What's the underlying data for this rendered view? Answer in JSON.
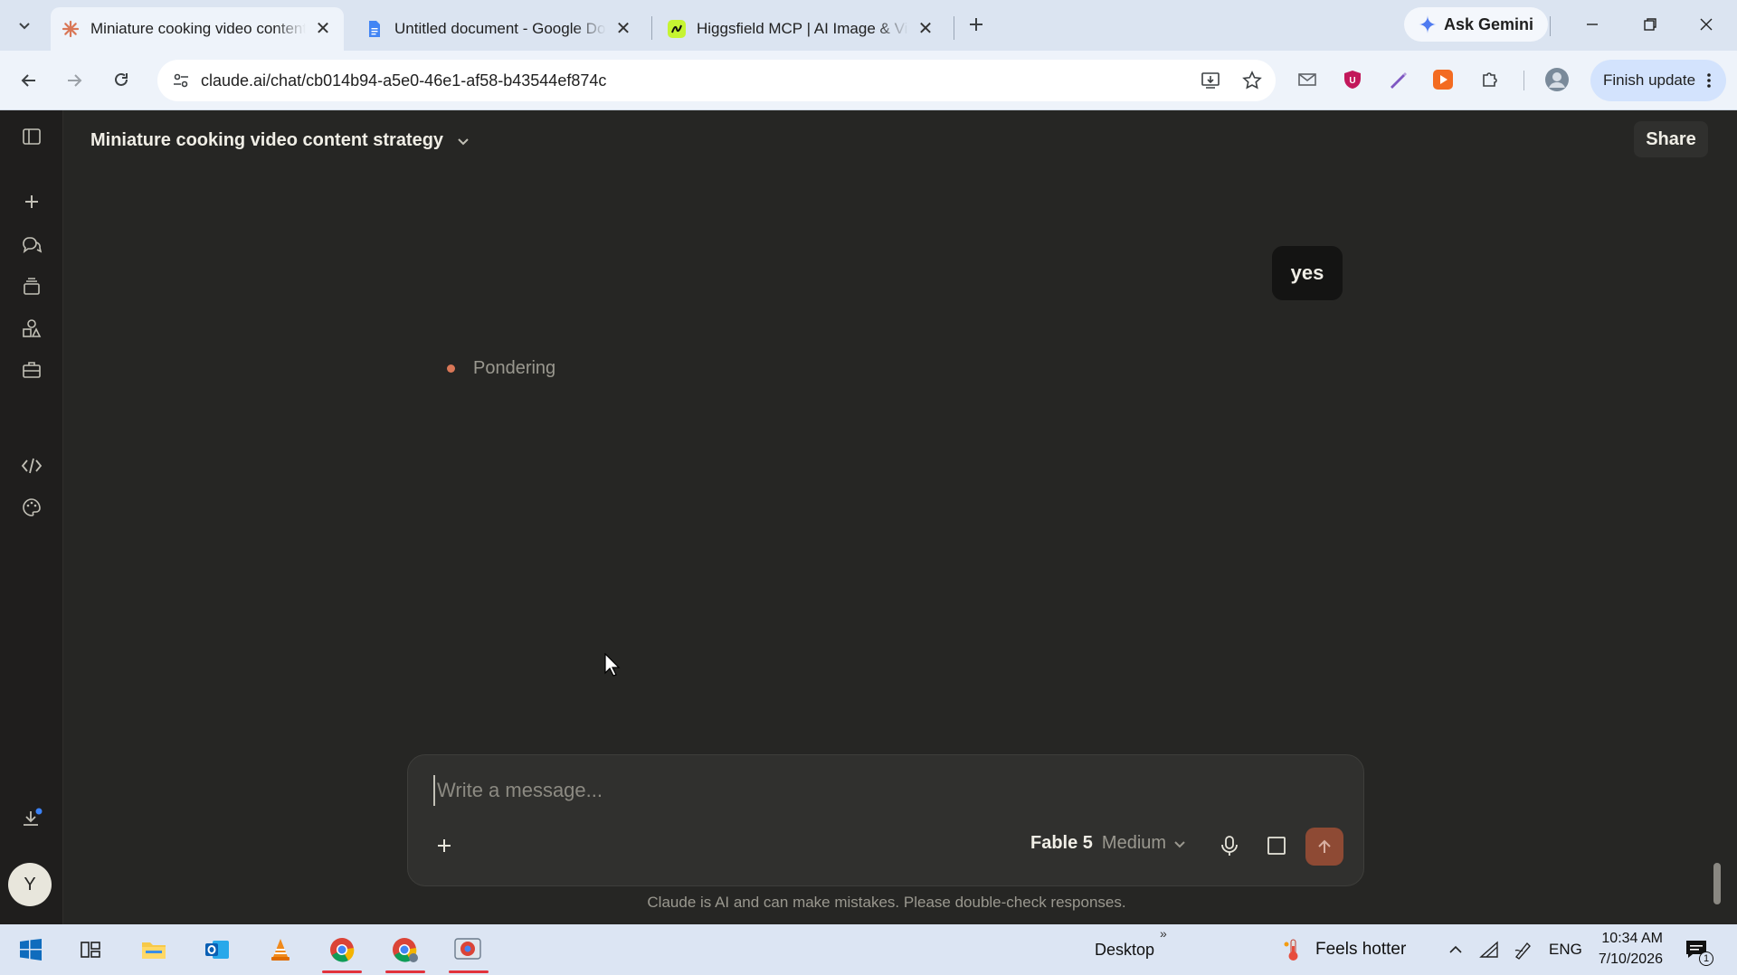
{
  "browser": {
    "tabs": [
      {
        "title": "Miniature cooking video content strategy",
        "icon": "claude-favicon",
        "active": true
      },
      {
        "title": "Untitled document - Google Docs",
        "icon": "google-docs-favicon",
        "active": false
      },
      {
        "title": "Higgsfield MCP | AI Image & Video",
        "icon": "higgsfield-favicon",
        "active": false
      }
    ],
    "ask_gemini_label": "Ask Gemini",
    "url": "claude.ai/chat/cb014b94-a5e0-46e1-af58-b43544ef874c",
    "finish_update_label": "Finish update"
  },
  "app": {
    "conversation_title": "Miniature cooking video content strategy",
    "share_label": "Share",
    "user_message": "yes",
    "status_text": "Pondering",
    "composer": {
      "placeholder": "Write a message...",
      "model_name": "Fable 5",
      "effort_level": "Medium"
    },
    "disclaimer": "Claude is AI and can make mistakes. Please double-check responses.",
    "avatar_initial": "Y",
    "accent_color": "#d97757"
  },
  "taskbar": {
    "desktop_label": "Desktop",
    "weather_text": "Feels hotter",
    "language": "ENG",
    "time": "10:34 AM",
    "date": "7/10/2026",
    "notification_count": "1"
  }
}
